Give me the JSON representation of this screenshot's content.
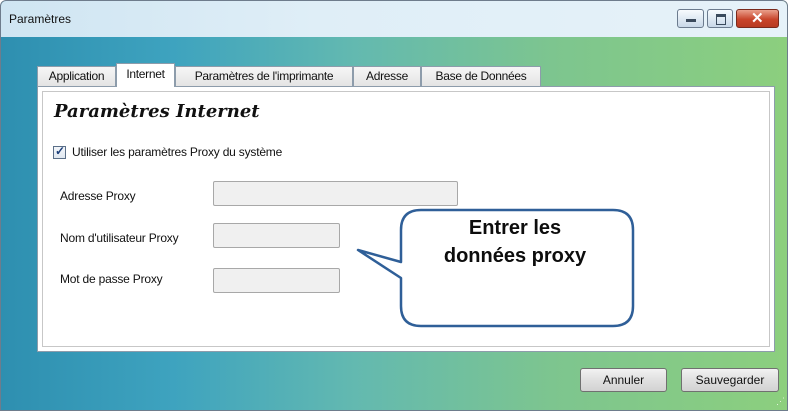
{
  "window": {
    "title": "Paramètres"
  },
  "tabs": [
    {
      "label": "Application",
      "active": false
    },
    {
      "label": "Internet",
      "active": true
    },
    {
      "label": "Paramètres de l'imprimante",
      "active": false
    },
    {
      "label": "Adresse",
      "active": false
    },
    {
      "label": "Base de Données",
      "active": false
    }
  ],
  "internet": {
    "heading": "Paramètres Internet",
    "use_system_proxy": {
      "label": "Utiliser les paramètres Proxy du système",
      "checked": true
    },
    "fields": [
      {
        "label": "Adresse Proxy",
        "value": ""
      },
      {
        "label": "Nom d'utilisateur Proxy",
        "value": ""
      },
      {
        "label": "Mot de passe Proxy",
        "value": ""
      }
    ]
  },
  "callout": {
    "line1": "Entrer les",
    "line2": "données proxy"
  },
  "buttons": {
    "cancel": "Annuler",
    "save": "Sauvegarder"
  }
}
